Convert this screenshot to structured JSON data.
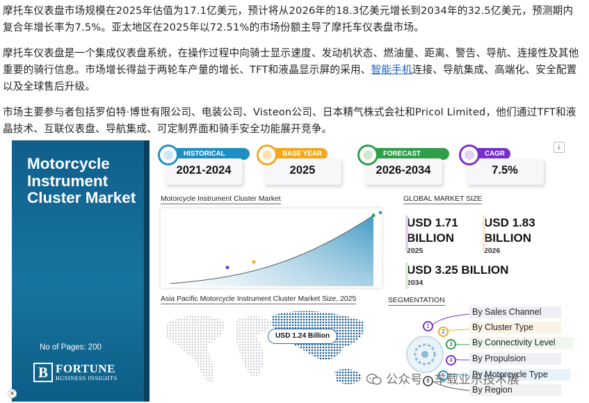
{
  "article": {
    "p1": "摩托车仪表盘市场规模在2025年估值为17.1亿美元，预计将从2026年的18.3亿美元增长到2034年的32.5亿美元，预测期内复合年增长率为7.5%。亚太地区在2025年以72.51%的市场份额主导了摩托车仪表盘市场。",
    "p2_before": "摩托车仪表盘是一个集成仪表盘系统，在操作过程中向骑士显示速度、发动机状态、燃油量、距离、警告、导航、连接性及其他重要的骑行信息。市场增长得益于两轮车产量的增长、TFT和液晶显示屏的采用、",
    "p2_link": "智能手机",
    "p2_after": "连接、导航集成、高端化、安全配置以及全球售后升级。",
    "p3": "市场主要参与者包括罗伯特·博世有限公司、电装公司、Visteon公司、日本精气株式会社和Pricol Limited，他们通过TFT和液晶技术、互联仪表盘、导航集成、可定制界面和骑手安全功能展开竞争。"
  },
  "infographic": {
    "title": "Motorcycle Instrument Cluster Market",
    "pages": "No of Pages: 200",
    "logo_main": "FORTUNE",
    "logo_sub": "BUSINESS INSIGHTS",
    "logo_mark": "B",
    "badges": [
      {
        "tag": "HISTORICAL PERIOD",
        "value": "2021-2024",
        "color": "#1f8fc3",
        "icon": "chart-icon"
      },
      {
        "tag": "BASE YEAR",
        "value": "2025",
        "color": "#f2a81d",
        "icon": "calendar-icon"
      },
      {
        "tag": "FORECAST PERIOD",
        "value": "2026-2034",
        "color": "#2e9e48",
        "icon": "forecast-icon"
      },
      {
        "tag": "CAGR",
        "value": "7.5%",
        "color": "#7b2fc9",
        "icon": "growth-icon"
      }
    ],
    "chart_label": "Motorcycle Instrument Cluster Market",
    "global_label": "GLOBAL MARKET SIZE",
    "stats": [
      {
        "amount": "USD 1.71 BILLION",
        "line1": "USD 1.71",
        "line2": "BILLION",
        "year": "2025",
        "color": "#dcd2ee"
      },
      {
        "amount": "USD 1.83 BILLION",
        "line1": "USD 1.83",
        "line2": "BILLION",
        "year": "2026",
        "color": "#fbe6cf"
      },
      {
        "amount": "USD 3.25 BILLION",
        "line1": "USD 3.25 BILLION",
        "year": "2034",
        "color": "#d8ecd5"
      }
    ],
    "map_label": "Asia Pacific Motorcycle Instrument Cluster Market Size, 2025",
    "map_value": "USD 1.24 Billion",
    "segmentation_label": "SEGMENTATION",
    "segments": [
      {
        "num": "1",
        "label": "By Sales Channel",
        "color": "#7b2fc9"
      },
      {
        "num": "2",
        "label": "By Cluster Type",
        "color": "#f2a81d"
      },
      {
        "num": "3",
        "label": "By Connectivity Level",
        "color": "#2e9e48"
      },
      {
        "num": "4",
        "label": "By Propulsion",
        "color": "#7b2fc9"
      },
      {
        "num": "5",
        "label": "By Motorcycle Type",
        "color": "#1f8fc3"
      },
      {
        "num": "6",
        "label": "By Region",
        "color": "#555555"
      }
    ]
  },
  "watermark": "公众号 · 车载业乐技术展",
  "close_glyph": "×",
  "download_glyph": "⤓",
  "colors": {
    "panel": "#15699a",
    "accent": "#1a5fc2"
  }
}
